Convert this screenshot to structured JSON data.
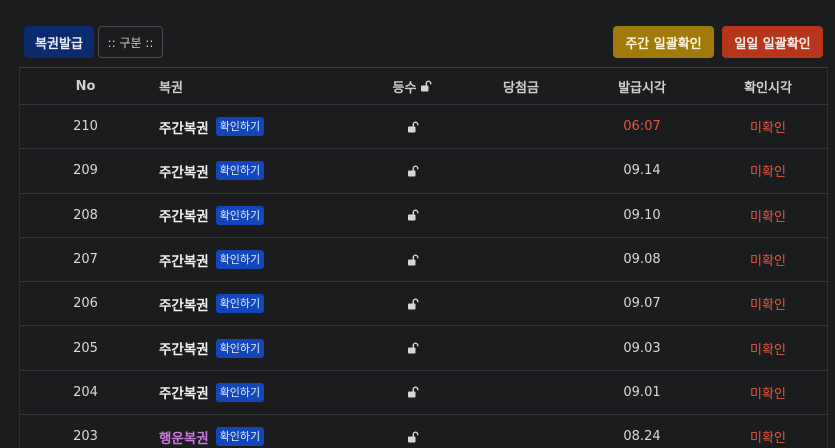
{
  "toolbar": {
    "issue_label": "복권발급",
    "category_label": ":: 구분 ::",
    "weekly_confirm_label": "주간 일괄확인",
    "daily_confirm_label": "일일 일괄확인"
  },
  "colors": {
    "issue_button": "#0c2a6e",
    "weekly_button": "#a07b09",
    "daily_button": "#b5361b",
    "badge": "#1346b8",
    "unchecked_text": "#e4573f",
    "lucky_ticket_text": "#c878d8"
  },
  "table": {
    "headers": {
      "no": "No",
      "ticket": "복권",
      "rank": "등수",
      "prize": "당첨금",
      "issued_at": "발급시각",
      "checked_at": "확인시각"
    },
    "rank_header_icon": "unlock-icon",
    "rows": [
      {
        "no": "210",
        "ticket": "주간복권",
        "action": "확인하기",
        "rank_icon": "unlock-icon",
        "prize": "",
        "issued_at": "06:07",
        "checked_at": "미확인"
      },
      {
        "no": "209",
        "ticket": "주간복권",
        "action": "확인하기",
        "rank_icon": "unlock-icon",
        "prize": "",
        "issued_at": "09.14",
        "checked_at": "미확인"
      },
      {
        "no": "208",
        "ticket": "주간복권",
        "action": "확인하기",
        "rank_icon": "unlock-icon",
        "prize": "",
        "issued_at": "09.10",
        "checked_at": "미확인"
      },
      {
        "no": "207",
        "ticket": "주간복권",
        "action": "확인하기",
        "rank_icon": "unlock-icon",
        "prize": "",
        "issued_at": "09.08",
        "checked_at": "미확인"
      },
      {
        "no": "206",
        "ticket": "주간복권",
        "action": "확인하기",
        "rank_icon": "unlock-icon",
        "prize": "",
        "issued_at": "09.07",
        "checked_at": "미확인"
      },
      {
        "no": "205",
        "ticket": "주간복권",
        "action": "확인하기",
        "rank_icon": "unlock-icon",
        "prize": "",
        "issued_at": "09.03",
        "checked_at": "미확인"
      },
      {
        "no": "204",
        "ticket": "주간복권",
        "action": "확인하기",
        "rank_icon": "unlock-icon",
        "prize": "",
        "issued_at": "09.01",
        "checked_at": "미확인"
      },
      {
        "no": "203",
        "ticket": "행운복권",
        "action": "확인하기",
        "rank_icon": "unlock-icon",
        "prize": "",
        "issued_at": "08.24",
        "checked_at": "미확인"
      }
    ]
  }
}
